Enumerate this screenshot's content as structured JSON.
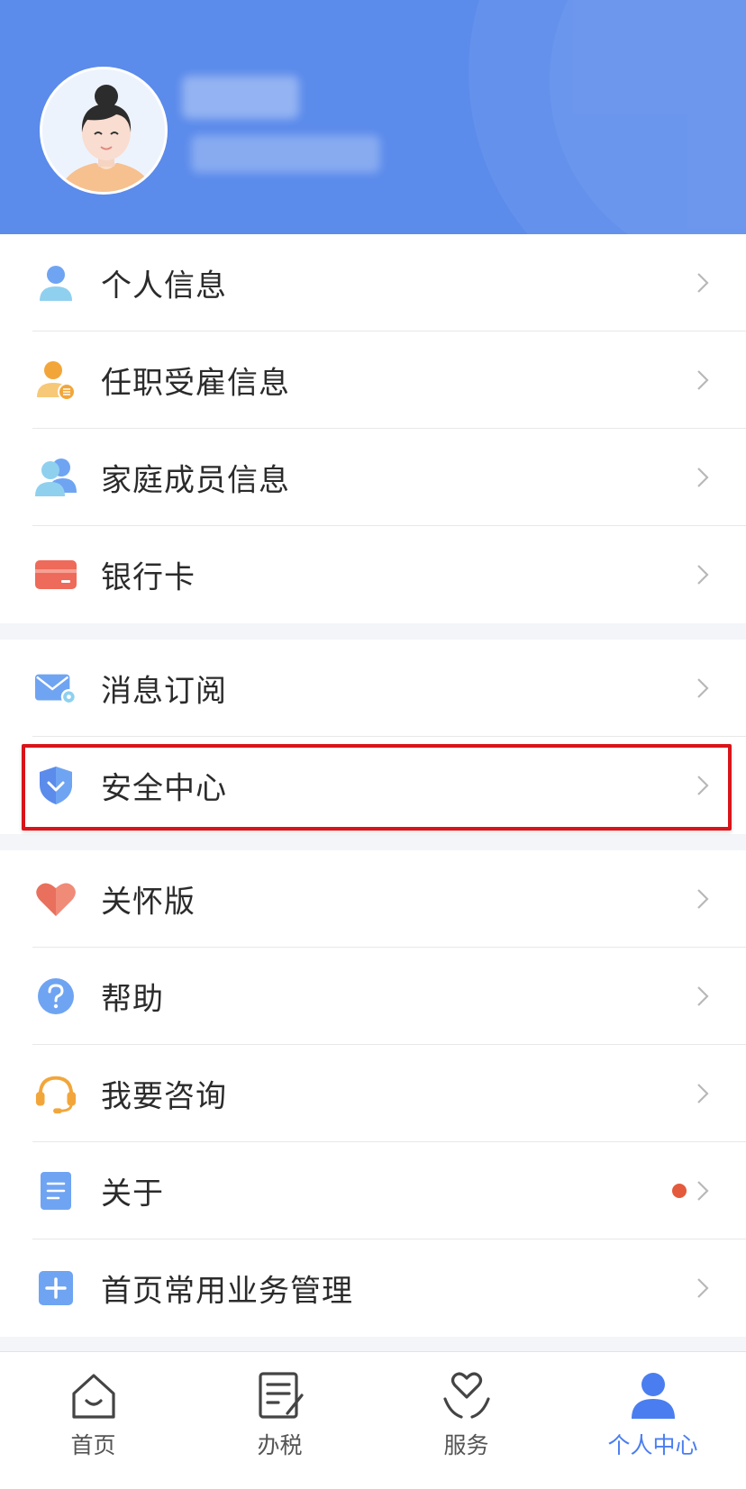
{
  "profile": {
    "avatar_icon": "female-avatar",
    "name_blurred": true,
    "sub_blurred": true
  },
  "menu_groups": [
    [
      {
        "label": "个人信息",
        "icon": "person-icon"
      },
      {
        "label": "任职受雇信息",
        "icon": "employment-icon"
      },
      {
        "label": "家庭成员信息",
        "icon": "family-icon"
      },
      {
        "label": "银行卡",
        "icon": "bank-card-icon"
      }
    ],
    [
      {
        "label": "消息订阅",
        "icon": "message-settings-icon"
      },
      {
        "label": "安全中心",
        "icon": "shield-icon",
        "highlighted": true
      }
    ],
    [
      {
        "label": "关怀版",
        "icon": "heart-icon"
      },
      {
        "label": "帮助",
        "icon": "help-icon"
      },
      {
        "label": "我要咨询",
        "icon": "headset-icon"
      },
      {
        "label": "关于",
        "icon": "document-icon",
        "badge": "red-dot"
      },
      {
        "label": "首页常用业务管理",
        "icon": "add-icon"
      }
    ]
  ],
  "tabbar": [
    {
      "label": "首页",
      "icon": "home-icon"
    },
    {
      "label": "办税",
      "icon": "tax-form-icon"
    },
    {
      "label": "服务",
      "icon": "service-heart-icon"
    },
    {
      "label": "个人中心",
      "icon": "profile-icon",
      "active": true
    }
  ],
  "colors": {
    "header_bg": "#5b8beb",
    "accent": "#4a7ef0",
    "highlight_border": "#d9141a",
    "badge": "#e45a3c"
  }
}
